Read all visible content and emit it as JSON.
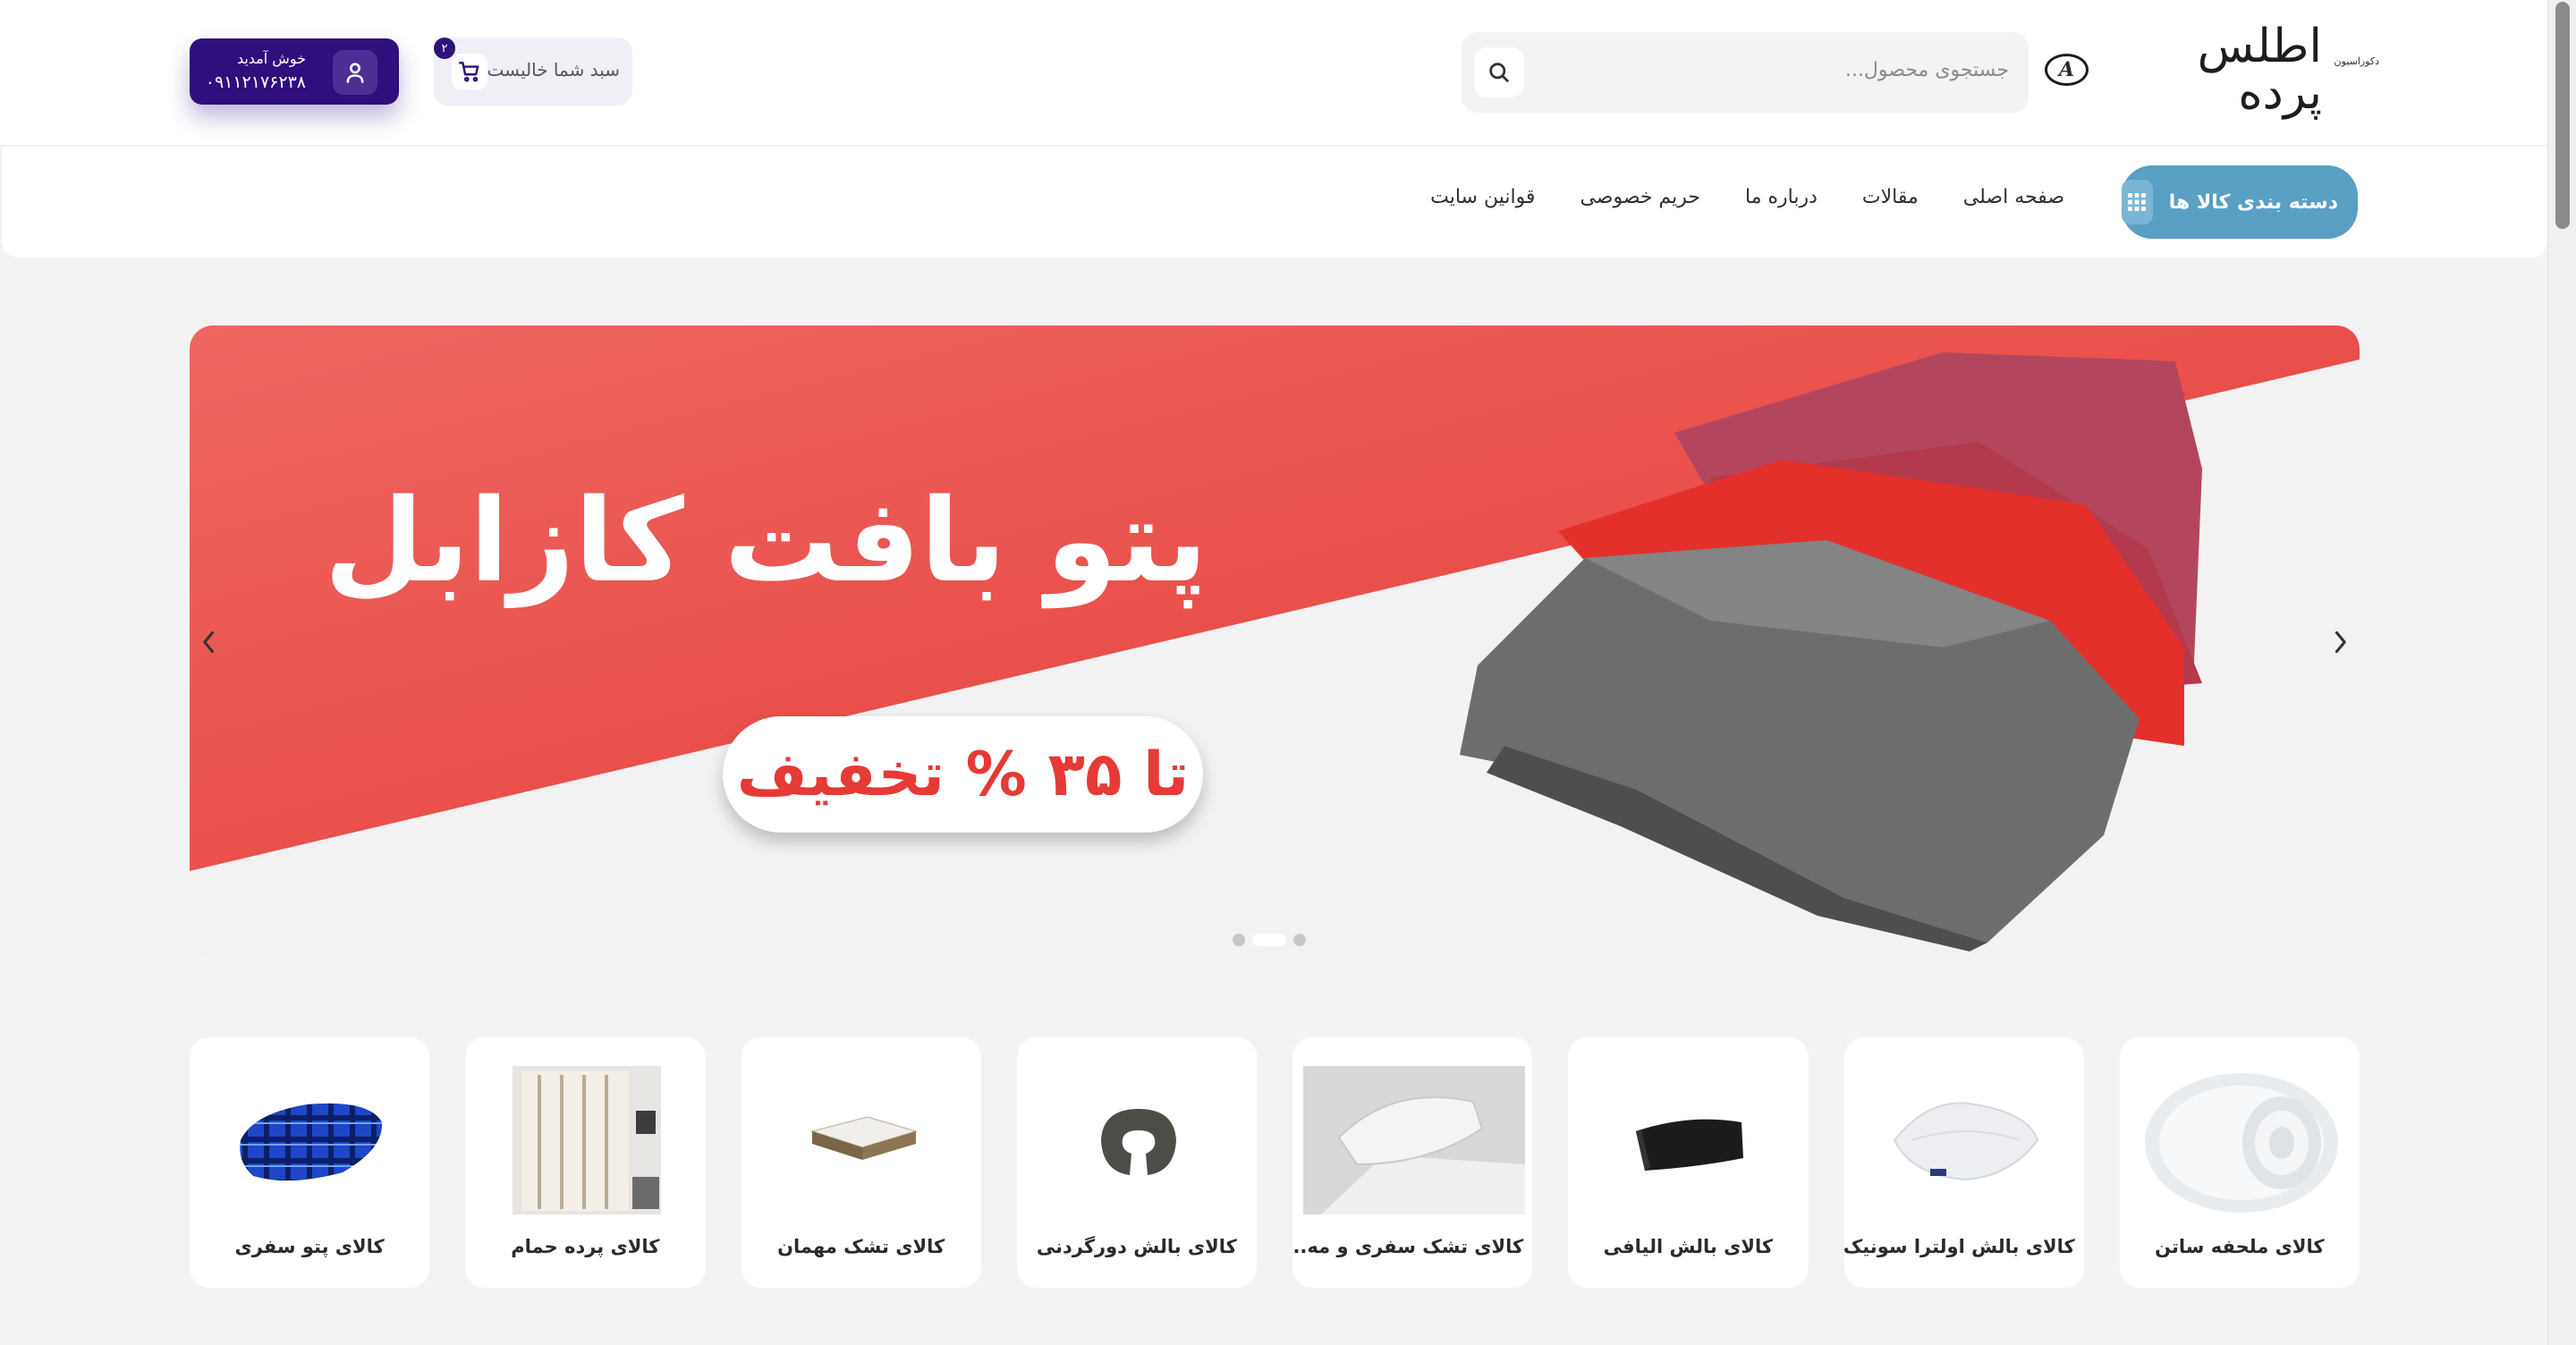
{
  "header": {
    "logo_text": "اطلس پرده",
    "logo_sub": "دکوراسیون",
    "search_placeholder": "جستجوی محصول...",
    "cart_label": "سبد شما خالیست",
    "cart_count": "۲",
    "user_welcome": "خوش آمدید",
    "user_phone": "۰۹۱۱۲۱۷۶۲۳۸"
  },
  "nav": {
    "category_button": "دسته بندی کالا ها",
    "links": [
      "صفحه اصلی",
      "مقالات",
      "درباره ما",
      "حریم خصوصی",
      "قوانین سایت"
    ]
  },
  "slider": {
    "title": "پتو بافت کازابل",
    "badge": "تا ۳۵ % تخفیف",
    "colors": {
      "red": "#e8413c",
      "light": "#f2f2f2"
    }
  },
  "categories": [
    {
      "title": "کالای ملحفه ساتن",
      "icon": "duvet-icon"
    },
    {
      "title": "کالای بالش اولترا سونیک",
      "icon": "pillow-icon"
    },
    {
      "title": "کالای بالش الیافی",
      "icon": "lumbar-pillow-icon"
    },
    {
      "title": "کالای تشک سفری و مه...",
      "icon": "travel-mattress-icon"
    },
    {
      "title": "کالای بالش دورگردنی",
      "icon": "neck-pillow-icon"
    },
    {
      "title": "کالای تشک مهمان",
      "icon": "mattress-icon"
    },
    {
      "title": "کالای پرده حمام",
      "icon": "shower-curtain-icon"
    },
    {
      "title": "کالای پتو سفری",
      "icon": "blanket-icon"
    }
  ],
  "theme": {
    "accent": "#2e0f7c",
    "nav_button": "#5a9fc4",
    "background": "#f3f3f4"
  }
}
